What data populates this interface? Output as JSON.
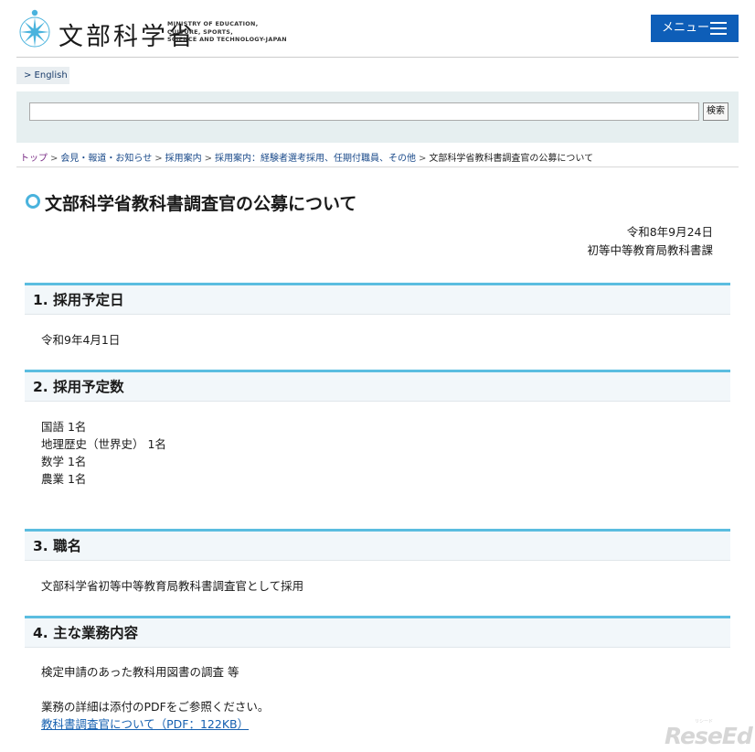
{
  "header": {
    "logo_jp": "文部科学省",
    "logo_en_lines": [
      "MINISTRY OF EDUCATION,",
      "CULTURE, SPORTS,",
      "SCIENCE AND TECHNOLOGY-JAPAN"
    ],
    "menu_label": "メニュー",
    "colors": {
      "menu": "#0e5eb8",
      "logo": "#4ab3dd"
    }
  },
  "english_link": "> English",
  "search": {
    "value": "",
    "button_label": "検索"
  },
  "breadcrumb": [
    "トップ",
    "会見・報道・お知らせ",
    "採用案内",
    "採用案内：経験者選考採用、任期付職員、その他",
    "文部科学省教科書調査官の公募について"
  ],
  "breadcrumb_sep": ">",
  "page_title": "文部科学省教科書調査官の公募について",
  "date": "令和8年9月24日",
  "issuer": "初等中等教育局教科書課",
  "sections": [
    {
      "heading": "1. 採用予定日",
      "lines": [
        "令和9年4月1日"
      ]
    },
    {
      "heading": "2. 採用予定数",
      "lines": [
        "国語 1名",
        "地理歴史（世界史） 1名",
        "数学 1名",
        "農業 1名"
      ]
    },
    {
      "heading": "3. 職名",
      "lines": [
        "文部科学省初等中等教育局教科書調査官として採用"
      ]
    },
    {
      "heading": "4. 主な業務内容",
      "lines": [
        "検定申請のあった教科用図書の調査 等"
      ],
      "note": "業務の詳細は添付のPDFをご参照ください。",
      "link": "教科書調査官について（PDF：122KB）"
    }
  ],
  "watermark": "ReseEd",
  "watermark_small": "リシード",
  "accent_color": "#5bbde0"
}
